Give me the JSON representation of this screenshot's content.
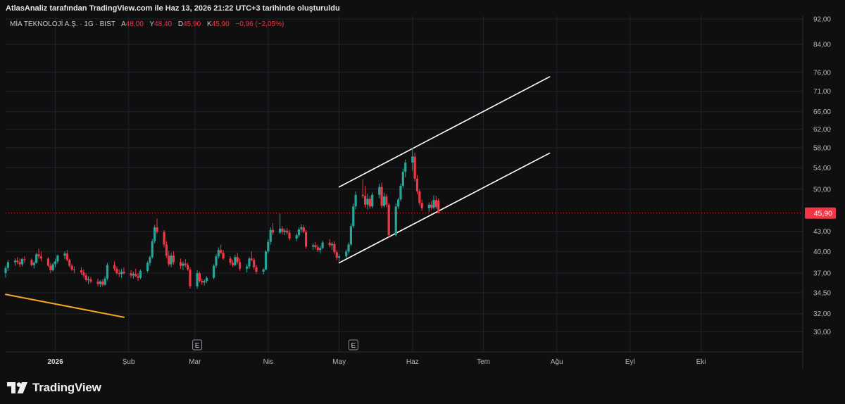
{
  "header": {
    "text": "AtlasAnaliz tarafından TradingView.com ile Haz 13, 2026 21:22 UTC+3 tarihinde oluşturuldu"
  },
  "legend": {
    "symbol": "MİA TEKNOLOJİ A.Ş. · 1G · BIST",
    "open_label": "A",
    "open": "48,00",
    "high_label": "Y",
    "high": "48,40",
    "low_label": "D",
    "low": "45,90",
    "close_label": "K",
    "close": "45,90",
    "change": "−0,96 (−2,05%)"
  },
  "footer": {
    "brand": "TradingView",
    "logo_icon": "tradingview-logo-icon"
  },
  "colors": {
    "background": "#0f0f0f",
    "up": "#26a69a",
    "down": "#f23645",
    "channel_line": "#ffffff",
    "trend_line": "#f5a623",
    "price_badge": "#f23645"
  },
  "chart_data": {
    "type": "candlestick",
    "symbol": "MİA TEKNOLOJİ A.Ş.",
    "interval": "1G",
    "exchange": "BIST",
    "y_scale": "log",
    "ylim": [
      29.5,
      92
    ],
    "y_ticks": [
      {
        "value": 92,
        "label": "92,00"
      },
      {
        "value": 84,
        "label": "84,00"
      },
      {
        "value": 76,
        "label": "76,00"
      },
      {
        "value": 71,
        "label": "71,00"
      },
      {
        "value": 66,
        "label": "66,00"
      },
      {
        "value": 62,
        "label": "62,00"
      },
      {
        "value": 58,
        "label": "58,00"
      },
      {
        "value": 54,
        "label": "54,00"
      },
      {
        "value": 50,
        "label": "50,00"
      },
      {
        "value": 43,
        "label": "43,00"
      },
      {
        "value": 40,
        "label": "40,00"
      },
      {
        "value": 37,
        "label": "37,00"
      },
      {
        "value": 34.5,
        "label": "34,50"
      },
      {
        "value": 32,
        "label": "32,00"
      },
      {
        "value": 30,
        "label": "30,00"
      }
    ],
    "x_range": [
      "2025-12-11",
      "2026-11-13"
    ],
    "x_ticks": [
      {
        "date": "2026-01-01",
        "label": "2026",
        "bold": true
      },
      {
        "date": "2026-02-01",
        "label": "Şub"
      },
      {
        "date": "2026-03-01",
        "label": "Mar"
      },
      {
        "date": "2026-04-01",
        "label": "Nis"
      },
      {
        "date": "2026-05-01",
        "label": "May"
      },
      {
        "date": "2026-06-01",
        "label": "Haz"
      },
      {
        "date": "2026-07-01",
        "label": "Tem"
      },
      {
        "date": "2026-08-01",
        "label": "Ağu"
      },
      {
        "date": "2026-09-01",
        "label": "Eyl"
      },
      {
        "date": "2026-10-01",
        "label": "Eki"
      }
    ],
    "last_price": {
      "value": 45.9,
      "label": "45,90"
    },
    "earnings_markers": [
      {
        "date": "2026-03-02",
        "label": "E"
      },
      {
        "date": "2026-05-07",
        "label": "E"
      }
    ],
    "channel_upper": [
      {
        "date": "2026-05-01",
        "value": 50.4
      },
      {
        "date": "2026-07-29",
        "value": 74.8
      }
    ],
    "channel_lower": [
      {
        "date": "2026-05-01",
        "value": 38.4
      },
      {
        "date": "2026-07-29",
        "value": 56.9
      }
    ],
    "trend_line": [
      {
        "date": "2025-12-11",
        "value": 34.3
      },
      {
        "date": "2026-01-30",
        "value": 31.6
      }
    ],
    "candles": [
      [
        "2025-12-11",
        37.0,
        38.0,
        36.4,
        37.7
      ],
      [
        "2025-12-12",
        37.7,
        38.8,
        37.3,
        38.5
      ],
      [
        "2025-12-15",
        38.5,
        39.0,
        38.0,
        38.7
      ],
      [
        "2025-12-16",
        38.7,
        39.2,
        38.2,
        38.5
      ],
      [
        "2025-12-17",
        38.5,
        39.0,
        37.8,
        38.2
      ],
      [
        "2025-12-18",
        38.2,
        39.1,
        37.9,
        38.9
      ],
      [
        "2025-12-19",
        38.9,
        39.3,
        38.4,
        38.8
      ],
      [
        "2025-12-22",
        38.8,
        39.0,
        37.9,
        38.1
      ],
      [
        "2025-12-23",
        38.1,
        38.6,
        37.6,
        38.4
      ],
      [
        "2025-12-24",
        38.4,
        39.8,
        38.3,
        39.6
      ],
      [
        "2025-12-25",
        39.6,
        40.4,
        39.0,
        39.3
      ],
      [
        "2025-12-26",
        39.3,
        40.0,
        38.6,
        39.0
      ],
      [
        "2025-12-29",
        39.0,
        39.2,
        37.8,
        38.0
      ],
      [
        "2025-12-30",
        38.0,
        38.4,
        37.0,
        37.4
      ],
      [
        "2025-12-31",
        37.4,
        38.5,
        37.2,
        38.2
      ],
      [
        "2026-01-01",
        38.2,
        39.0,
        37.8,
        38.6
      ],
      [
        "2026-01-02",
        38.6,
        39.6,
        38.3,
        39.4
      ],
      [
        "2026-01-05",
        39.4,
        40.0,
        38.9,
        39.7
      ],
      [
        "2026-01-06",
        39.7,
        40.2,
        38.6,
        38.8
      ],
      [
        "2026-01-07",
        38.8,
        39.0,
        37.8,
        38.0
      ],
      [
        "2026-01-08",
        38.0,
        38.2,
        37.3,
        37.5
      ],
      [
        "2026-01-09",
        37.5,
        37.9,
        37.0,
        37.4
      ],
      [
        "2026-01-12",
        37.4,
        37.8,
        36.8,
        37.1
      ],
      [
        "2026-01-13",
        37.1,
        37.5,
        36.4,
        36.7
      ],
      [
        "2026-01-14",
        36.7,
        37.0,
        35.9,
        36.1
      ],
      [
        "2026-01-15",
        36.1,
        36.6,
        35.6,
        36.2
      ],
      [
        "2026-01-16",
        36.2,
        36.5,
        35.7,
        35.9
      ],
      [
        "2026-01-19",
        35.9,
        36.3,
        35.3,
        35.6
      ],
      [
        "2026-01-20",
        35.6,
        36.1,
        35.2,
        35.9
      ],
      [
        "2026-01-21",
        35.9,
        36.2,
        35.3,
        35.5
      ],
      [
        "2026-01-22",
        35.5,
        36.6,
        35.4,
        36.3
      ],
      [
        "2026-01-23",
        36.3,
        38.4,
        36.1,
        38.1
      ],
      [
        "2026-01-26",
        38.1,
        38.6,
        37.3,
        37.6
      ],
      [
        "2026-01-27",
        37.6,
        37.9,
        36.8,
        37.0
      ],
      [
        "2026-01-28",
        37.0,
        37.5,
        36.5,
        36.9
      ],
      [
        "2026-01-29",
        36.9,
        37.6,
        36.4,
        37.2
      ],
      [
        "2026-01-30",
        37.2,
        37.8,
        36.8,
        37.0
      ],
      [
        "2026-02-02",
        37.0,
        37.4,
        36.4,
        36.7
      ],
      [
        "2026-02-03",
        36.7,
        37.2,
        36.3,
        36.9
      ],
      [
        "2026-02-04",
        36.9,
        37.6,
        36.5,
        36.6
      ],
      [
        "2026-02-05",
        36.6,
        37.0,
        36.0,
        36.4
      ],
      [
        "2026-02-06",
        36.4,
        37.5,
        36.2,
        37.3
      ],
      [
        "2026-02-09",
        37.3,
        38.6,
        37.1,
        38.4
      ],
      [
        "2026-02-10",
        38.4,
        39.4,
        38.0,
        39.2
      ],
      [
        "2026-02-11",
        39.2,
        41.8,
        39.0,
        41.5
      ],
      [
        "2026-02-12",
        41.5,
        44.0,
        41.2,
        43.6
      ],
      [
        "2026-02-13",
        43.6,
        45.0,
        42.6,
        42.9
      ],
      [
        "2026-02-16",
        42.9,
        43.2,
        40.6,
        41.0
      ],
      [
        "2026-02-17",
        41.0,
        41.5,
        39.1,
        39.4
      ],
      [
        "2026-02-18",
        39.4,
        40.1,
        37.9,
        38.2
      ],
      [
        "2026-02-19",
        38.2,
        39.8,
        37.8,
        39.4
      ],
      [
        "2026-02-20",
        39.4,
        40.0,
        38.2,
        38.5
      ],
      [
        "2026-02-23",
        38.5,
        39.0,
        37.6,
        38.0
      ],
      [
        "2026-02-24",
        38.0,
        38.6,
        37.4,
        38.3
      ],
      [
        "2026-02-25",
        38.3,
        38.9,
        37.8,
        38.1
      ],
      [
        "2026-02-26",
        38.1,
        38.4,
        37.3,
        37.5
      ],
      [
        "2026-02-27",
        37.5,
        37.8,
        35.0,
        35.3
      ],
      [
        "2026-03-02",
        35.3,
        37.4,
        35.0,
        37.0
      ],
      [
        "2026-03-03",
        37.0,
        37.2,
        35.8,
        36.0
      ],
      [
        "2026-03-04",
        36.0,
        36.3,
        35.5,
        35.8
      ],
      [
        "2026-03-05",
        35.8,
        36.2,
        35.4,
        36.0
      ],
      [
        "2026-03-06",
        36.0,
        36.6,
        35.7,
        36.4
      ],
      [
        "2026-03-09",
        36.4,
        38.2,
        36.2,
        38.0
      ],
      [
        "2026-03-10",
        38.0,
        39.6,
        37.7,
        39.3
      ],
      [
        "2026-03-11",
        39.3,
        40.6,
        39.0,
        40.2
      ],
      [
        "2026-03-12",
        40.2,
        41.0,
        39.6,
        39.8
      ],
      [
        "2026-03-13",
        39.8,
        40.2,
        38.8,
        39.0
      ],
      [
        "2026-03-16",
        39.0,
        39.3,
        38.1,
        38.4
      ],
      [
        "2026-03-17",
        38.4,
        38.8,
        37.8,
        38.1
      ],
      [
        "2026-03-18",
        38.1,
        39.5,
        37.9,
        39.2
      ],
      [
        "2026-03-19",
        39.2,
        39.8,
        38.2,
        38.5
      ],
      [
        "2026-03-20",
        38.5,
        39.0,
        37.3,
        37.6
      ],
      [
        "2026-03-23",
        37.6,
        38.2,
        37.1,
        37.9
      ],
      [
        "2026-03-24",
        37.9,
        39.2,
        37.6,
        39.0
      ],
      [
        "2026-03-25",
        39.0,
        40.0,
        38.6,
        38.8
      ],
      [
        "2026-03-26",
        38.8,
        39.1,
        37.5,
        37.8
      ],
      [
        "2026-03-27",
        37.8,
        38.1,
        36.9,
        37.2
      ],
      [
        "2026-03-30",
        37.2,
        37.7,
        36.8,
        37.5
      ],
      [
        "2026-03-31",
        37.5,
        40.2,
        37.4,
        40.0
      ],
      [
        "2026-04-01",
        40.0,
        41.8,
        39.7,
        41.4
      ],
      [
        "2026-04-02",
        41.4,
        43.6,
        41.0,
        43.2
      ],
      [
        "2026-04-03",
        43.2,
        44.3,
        42.4,
        42.8
      ],
      [
        "2026-04-06",
        42.8,
        45.8,
        42.6,
        43.4
      ],
      [
        "2026-04-07",
        43.4,
        43.8,
        42.5,
        42.9
      ],
      [
        "2026-04-08",
        42.9,
        43.4,
        42.4,
        43.1
      ],
      [
        "2026-04-09",
        43.1,
        43.5,
        42.5,
        42.8
      ],
      [
        "2026-04-10",
        42.8,
        43.2,
        41.6,
        41.9
      ],
      [
        "2026-04-13",
        41.9,
        42.7,
        41.5,
        42.4
      ],
      [
        "2026-04-14",
        42.4,
        43.6,
        42.1,
        43.3
      ],
      [
        "2026-04-15",
        43.3,
        44.1,
        42.8,
        43.6
      ],
      [
        "2026-04-16",
        43.6,
        44.0,
        42.7,
        42.9
      ],
      [
        "2026-04-17",
        42.9,
        43.2,
        40.4,
        40.7
      ],
      [
        "2026-04-20",
        40.7,
        41.2,
        40.2,
        40.9
      ],
      [
        "2026-04-21",
        40.9,
        41.4,
        40.3,
        40.6
      ],
      [
        "2026-04-22",
        40.6,
        41.0,
        39.9,
        40.2
      ],
      [
        "2026-04-23",
        40.2,
        40.8,
        39.7,
        40.5
      ],
      [
        "2026-04-24",
        40.5,
        41.6,
        40.3,
        41.3
      ],
      [
        "2026-04-27",
        41.3,
        41.8,
        40.6,
        40.9
      ],
      [
        "2026-04-28",
        40.9,
        41.4,
        40.2,
        41.1
      ],
      [
        "2026-04-29",
        41.1,
        41.5,
        39.6,
        39.9
      ],
      [
        "2026-04-30",
        39.9,
        40.2,
        38.8,
        39.1
      ],
      [
        "2026-05-01",
        39.1,
        39.6,
        38.5,
        39.3
      ],
      [
        "2026-05-04",
        39.3,
        40.3,
        39.0,
        40.0
      ],
      [
        "2026-05-05",
        40.0,
        41.3,
        39.7,
        41.0
      ],
      [
        "2026-05-06",
        41.0,
        44.2,
        40.8,
        43.8
      ],
      [
        "2026-05-07",
        43.8,
        47.5,
        43.5,
        47.0
      ],
      [
        "2026-05-08",
        47.0,
        49.6,
        46.5,
        49.0
      ],
      [
        "2026-05-11",
        49.0,
        51.8,
        48.4,
        48.8
      ],
      [
        "2026-05-12",
        48.8,
        50.6,
        46.8,
        47.3
      ],
      [
        "2026-05-13",
        47.3,
        49.2,
        46.5,
        48.3
      ],
      [
        "2026-05-14",
        48.3,
        48.8,
        46.6,
        47.0
      ],
      [
        "2026-05-15",
        47.0,
        49.4,
        46.7,
        49.0
      ],
      [
        "2026-05-18",
        49.0,
        51.0,
        48.4,
        50.4
      ],
      [
        "2026-05-19",
        50.4,
        51.2,
        46.7,
        47.1
      ],
      [
        "2026-05-20",
        47.1,
        49.4,
        46.8,
        48.7
      ],
      [
        "2026-05-21",
        48.7,
        49.1,
        46.9,
        47.3
      ],
      [
        "2026-05-22",
        47.3,
        47.6,
        42.0,
        42.4
      ],
      [
        "2026-05-25",
        42.4,
        47.5,
        42.2,
        47.0
      ],
      [
        "2026-05-26",
        47.0,
        48.5,
        46.6,
        48.2
      ],
      [
        "2026-05-27",
        48.2,
        51.0,
        47.9,
        50.6
      ],
      [
        "2026-05-28",
        50.6,
        53.8,
        50.2,
        53.2
      ],
      [
        "2026-05-29",
        53.2,
        55.6,
        52.2,
        55.0
      ],
      [
        "2026-06-01",
        55.0,
        58.0,
        53.4,
        56.2
      ],
      [
        "2026-06-02",
        56.2,
        57.0,
        51.4,
        51.9
      ],
      [
        "2026-06-03",
        51.9,
        52.6,
        49.1,
        49.6
      ],
      [
        "2026-06-04",
        49.6,
        50.0,
        47.2,
        47.6
      ],
      [
        "2026-06-05",
        47.6,
        48.2,
        46.3,
        46.7
      ],
      [
        "2026-06-08",
        46.7,
        47.7,
        46.1,
        47.3
      ],
      [
        "2026-06-09",
        47.3,
        47.9,
        46.4,
        46.8
      ],
      [
        "2026-06-10",
        46.8,
        48.9,
        46.5,
        48.1
      ],
      [
        "2026-06-11",
        48.1,
        48.8,
        46.6,
        46.9
      ],
      [
        "2026-06-12",
        48.0,
        48.4,
        45.9,
        45.9
      ]
    ]
  }
}
